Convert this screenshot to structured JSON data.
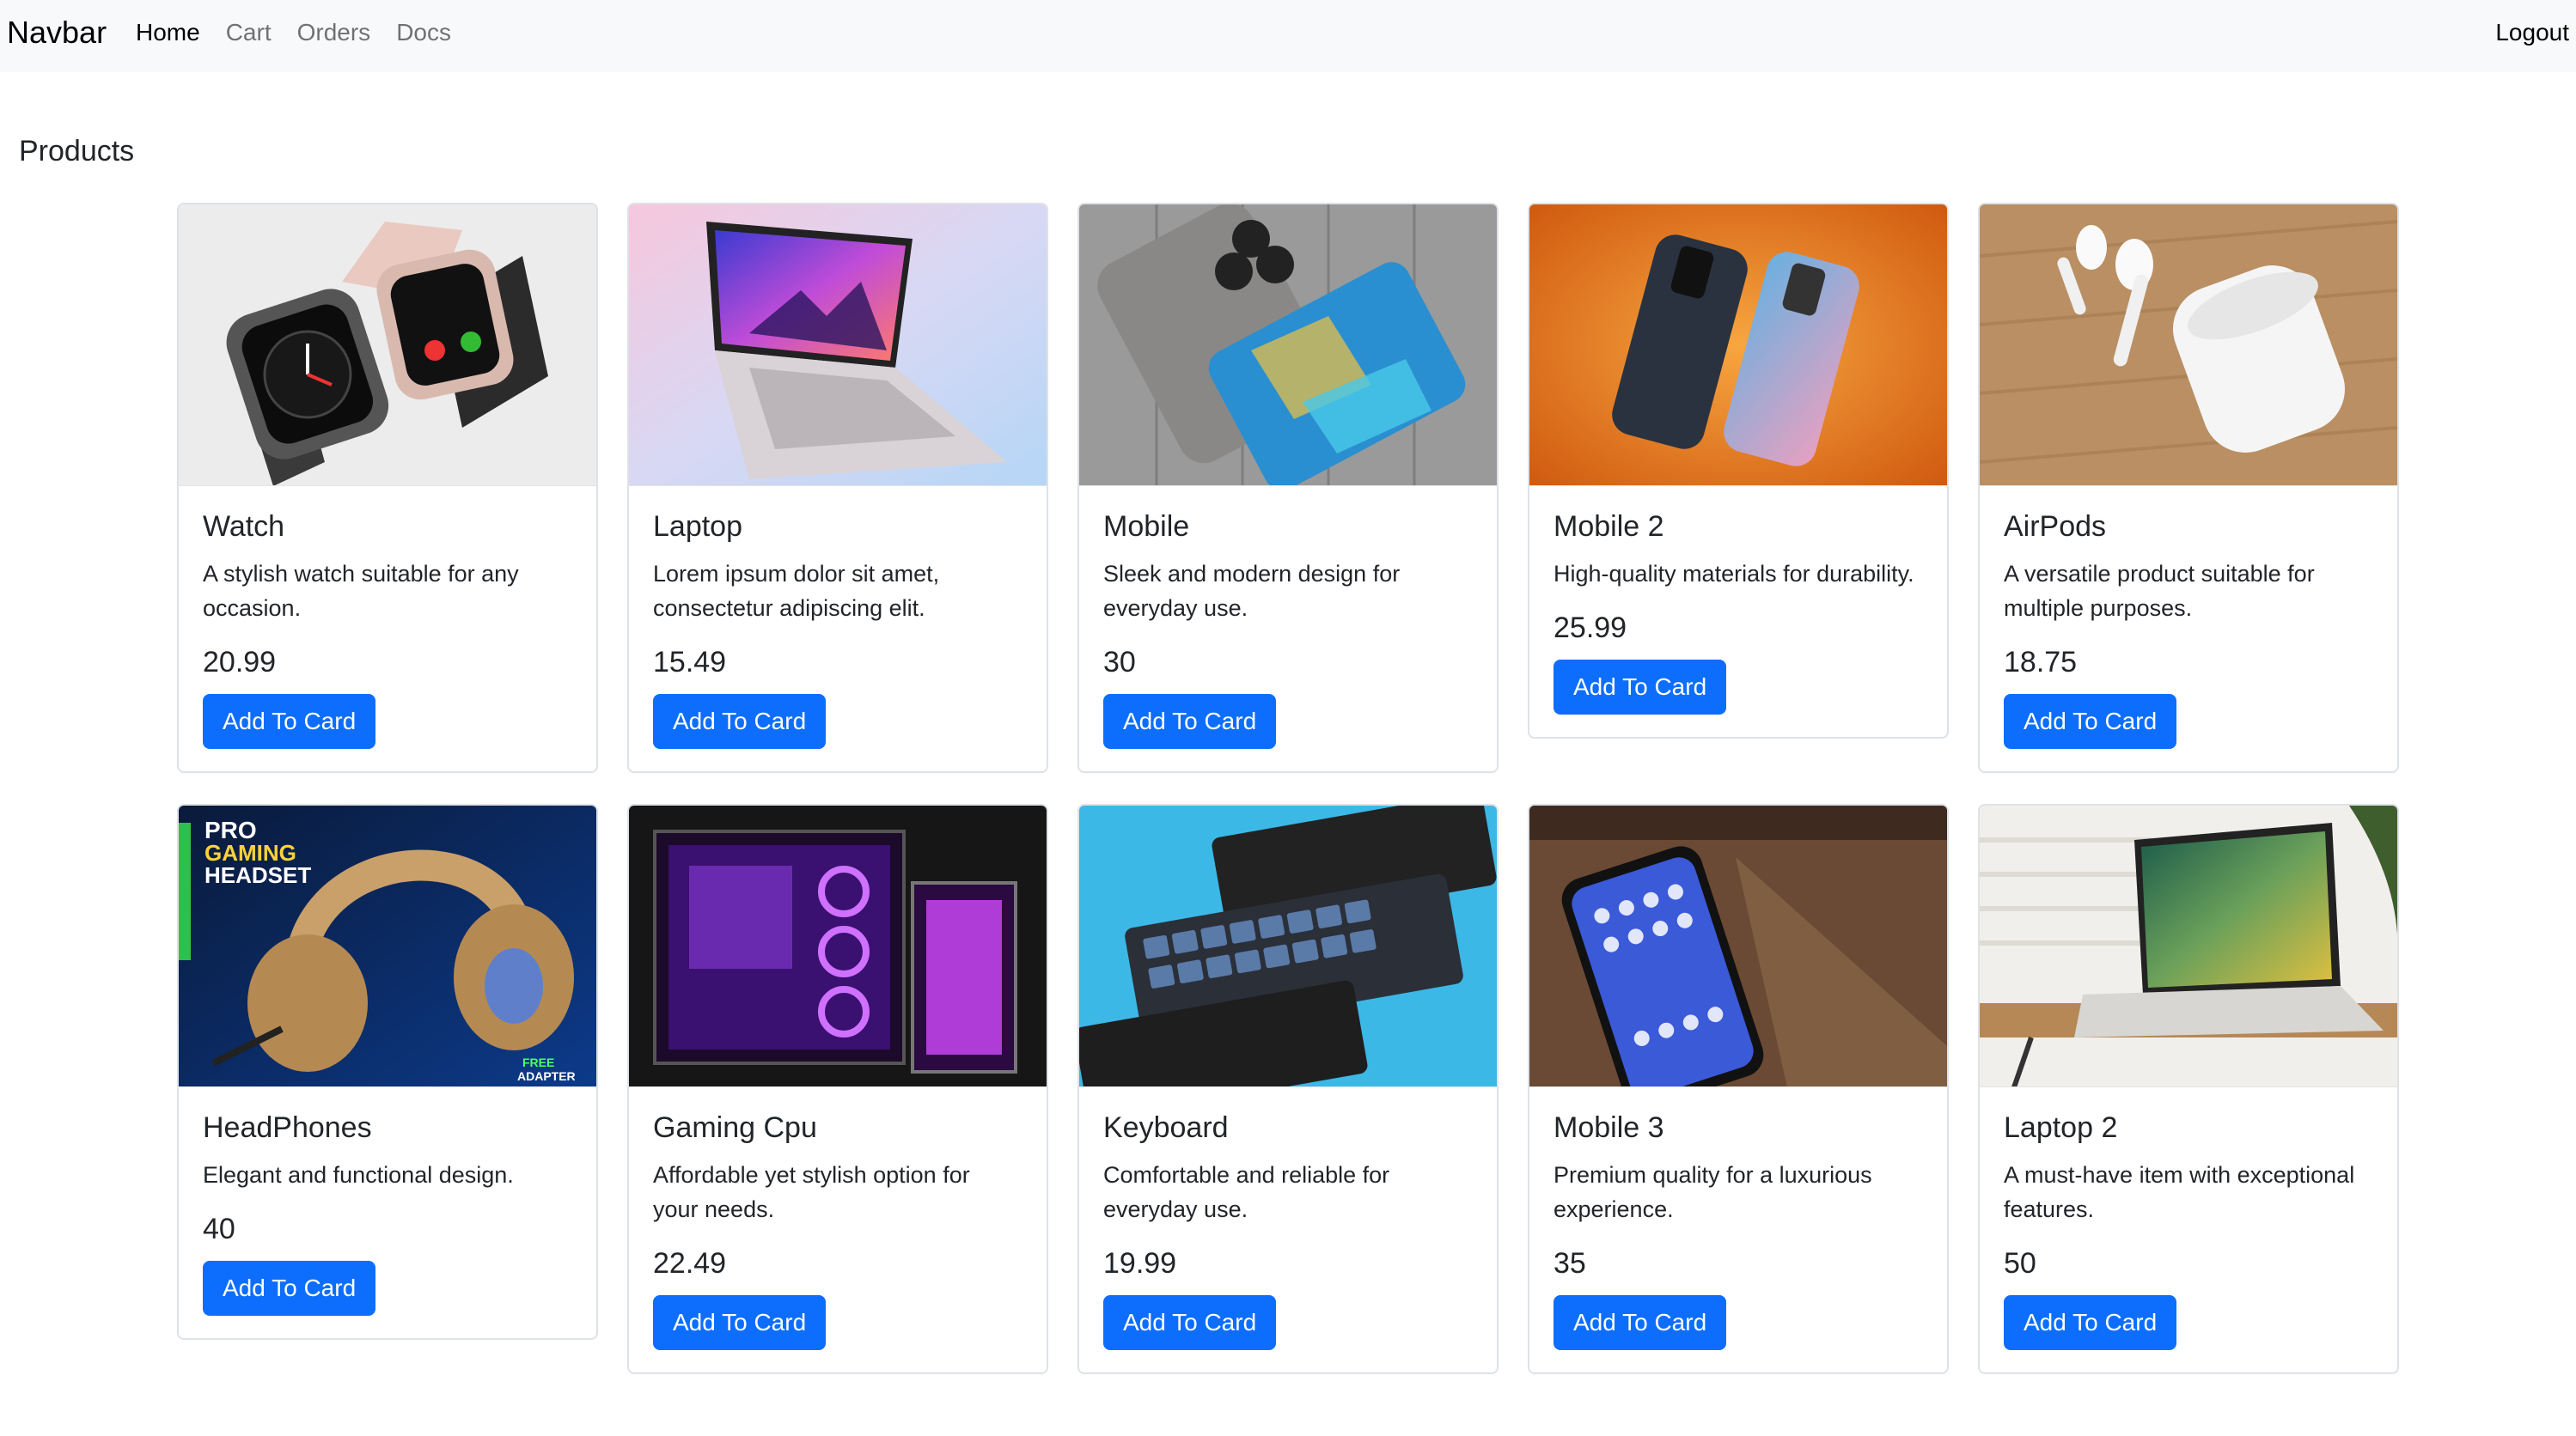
{
  "navbar": {
    "brand": "Navbar",
    "links": [
      "Home",
      "Cart",
      "Orders",
      "Docs"
    ],
    "active": "Home",
    "logout_label": "Logout"
  },
  "page": {
    "title": "Products"
  },
  "products": [
    {
      "name": "Watch",
      "description": "A stylish watch suitable for any occasion.",
      "price": "20.99",
      "button": "Add To Card",
      "image": "smartwatch-image"
    },
    {
      "name": "Laptop",
      "description": "Lorem ipsum dolor sit amet, consectetur adipiscing elit.",
      "price": "15.49",
      "button": "Add To Card",
      "image": "laptop-image"
    },
    {
      "name": "Mobile",
      "description": "Sleek and modern design for everyday use.",
      "price": "30",
      "button": "Add To Card",
      "image": "phones-on-wood-image"
    },
    {
      "name": "Mobile 2",
      "description": "High-quality materials for durability.",
      "price": "25.99",
      "button": "Add To Card",
      "image": "phones-orange-bg-image"
    },
    {
      "name": "AirPods",
      "description": "A versatile product suitable for multiple purposes.",
      "price": "18.75",
      "button": "Add To Card",
      "image": "airpods-image"
    },
    {
      "name": "HeadPhones",
      "description": "Elegant and functional design.",
      "price": "40",
      "button": "Add To Card",
      "image": "gaming-headset-image",
      "image_text": [
        "PRO",
        "GAMING",
        "HEADSET",
        "FREE",
        "ADAPTER"
      ]
    },
    {
      "name": "Gaming Cpu",
      "description": "Affordable yet stylish option for your needs.",
      "price": "22.49",
      "button": "Add To Card",
      "image": "gaming-pc-image"
    },
    {
      "name": "Keyboard",
      "description": "Comfortable and reliable for everyday use.",
      "price": "19.99",
      "button": "Add To Card",
      "image": "keyboards-image"
    },
    {
      "name": "Mobile 3",
      "description": "Premium quality for a luxurious experience.",
      "price": "35",
      "button": "Add To Card",
      "image": "phone-closeup-image"
    },
    {
      "name": "Laptop 2",
      "description": "A must-have item with exceptional features.",
      "price": "50",
      "button": "Add To Card",
      "image": "laptop-on-table-image"
    }
  ],
  "colors": {
    "primary": "#0d6efd",
    "navbar_bg": "#f8f9fa",
    "border": "#dee2e6"
  }
}
